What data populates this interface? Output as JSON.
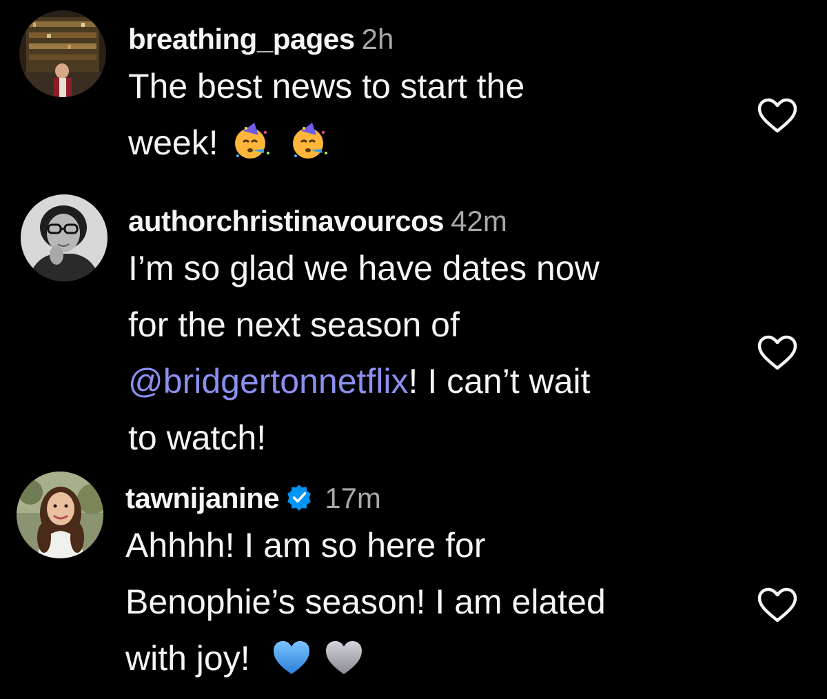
{
  "comments": [
    {
      "username": "breathing_pages",
      "time": "2h",
      "verified": false,
      "lines": [
        "The best news to start the",
        "week!"
      ],
      "emojis": [
        "partying-face-emoji",
        "partying-face-emoji"
      ]
    },
    {
      "username": "authorchristinavourcos",
      "time": "42m",
      "verified": false,
      "lines": [
        "I’m so glad we have dates now",
        "for the next season of"
      ],
      "mention": "@bridgertonnetflix",
      "after_mention": "! I can’t wait",
      "last_line": "to watch!"
    },
    {
      "username": "tawnijanine",
      "time": "17m",
      "verified": true,
      "lines": [
        "Ahhhh! I am so here for",
        "Benophie’s season! I am elated",
        "with joy!"
      ],
      "emojis": [
        "blue-heart-emoji",
        "grey-heart-emoji"
      ]
    }
  ],
  "colors": {
    "background": "#000000",
    "text": "#f5f5f5",
    "timestamp": "#a8a8a8",
    "mention": "#8a8ff0",
    "verified_badge": "#0095f6",
    "like_icon": "#f5f5f5"
  },
  "icons": {
    "like": "heart-outline-icon",
    "verified": "verified-badge-icon"
  }
}
